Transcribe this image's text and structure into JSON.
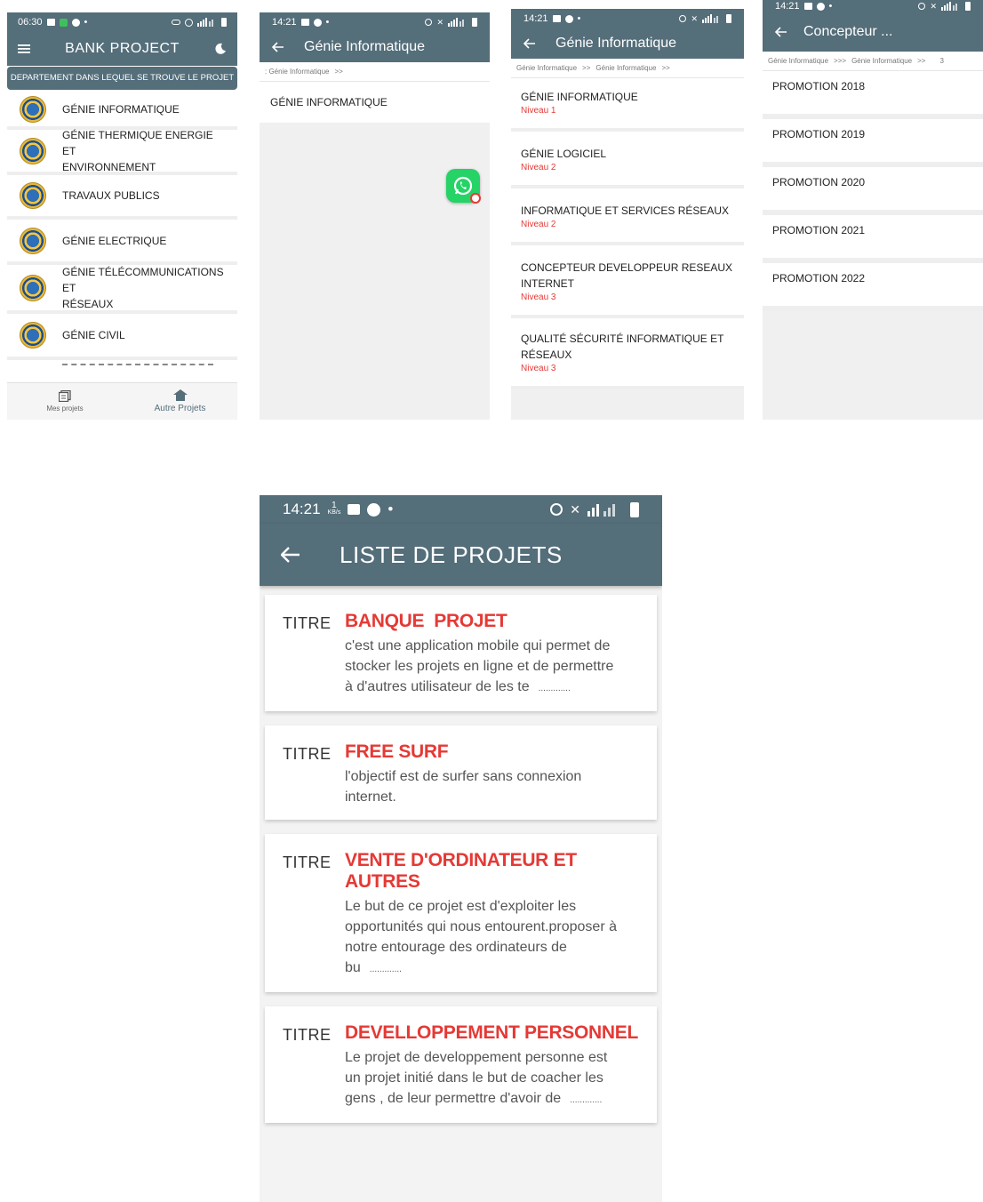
{
  "screen1": {
    "status_time": "06:30",
    "app_title": "BANK PROJECT",
    "section_header": "DEPARTEMENT DANS LEQUEL SE TROUVE LE PROJET",
    "departments": [
      {
        "line1": "GÉNIE INFORMATIQUE",
        "line2": ""
      },
      {
        "line1": "GÉNIE THERMIQUE ENERGIE ET",
        "line2": "ENVIRONNEMENT"
      },
      {
        "line1": "TRAVAUX PUBLICS",
        "line2": ""
      },
      {
        "line1": "GÉNIE ELECTRIQUE",
        "line2": ""
      },
      {
        "line1": "GÉNIE TÉLÉCOMMUNICATIONS ET",
        "line2": "RÉSEAUX"
      },
      {
        "line1": "GÉNIE CIVIL",
        "line2": ""
      }
    ],
    "nav": {
      "left_label": "Mes projets",
      "right_label": "Autre Projets"
    }
  },
  "screen2": {
    "status_time": "14:21",
    "title": "Génie Informatique",
    "crumbs": [
      ": Génie Informatique",
      ">>"
    ],
    "items": [
      "GÉNIE INFORMATIQUE"
    ]
  },
  "screen3": {
    "status_time": "14:21",
    "title": "Génie Informatique",
    "crumbs": [
      "Génie Informatique",
      ">>",
      "Génie Informatique",
      ">>"
    ],
    "items": [
      {
        "line1": "GÉNIE INFORMATIQUE",
        "line2": "",
        "niveau": "Niveau 1"
      },
      {
        "line1": "GÉNIE LOGICIEL",
        "line2": "",
        "niveau": "Niveau 2"
      },
      {
        "line1": "INFORMATIQUE ET SERVICES RÉSEAUX",
        "line2": "",
        "niveau": "Niveau 2"
      },
      {
        "line1": "CONCEPTEUR DEVELOPPEUR RESEAUX",
        "line2": "INTERNET",
        "niveau": "Niveau 3"
      },
      {
        "line1": "QUALITÉ SÉCURITÉ INFORMATIQUE ET",
        "line2": "RÉSEAUX",
        "niveau": "Niveau 3"
      }
    ]
  },
  "screen4": {
    "status_time": "14:21",
    "title": "Concepteur ...",
    "crumbs": [
      "Génie Informatique",
      ">>>",
      "Génie Informatique",
      ">>",
      "3"
    ],
    "items": [
      "PROMOTION 2018",
      "PROMOTION 2019",
      "PROMOTION 2020",
      "PROMOTION 2021",
      "PROMOTION 2022"
    ]
  },
  "screen5": {
    "status_time": "14:21",
    "status_speed_top": "1",
    "status_speed_unit": "KB/s",
    "title": "LISTE DE PROJETS",
    "projects": [
      {
        "label": "TITRE",
        "title": "BANQUE  PROJET",
        "lines": [
          "c'est une application mobile qui permet de",
          "stocker les projets en ligne et de permettre",
          "à d'autres utilisateur de les te"
        ],
        "dots": "............."
      },
      {
        "label": "TITRE",
        "title": "FREE SURF",
        "lines": [
          "l'objectif est de surfer sans connexion",
          "internet."
        ],
        "dots": ""
      },
      {
        "label": "TITRE",
        "title": "VENTE D'ORDINATEUR ET AUTRES",
        "lines": [
          "Le but de ce projet est d'exploiter les",
          "opportunités qui nous entourent.proposer à",
          "notre entourage des ordinateurs de",
          "bu"
        ],
        "dots": "............."
      },
      {
        "label": "TITRE",
        "title": "DEVELLOPPEMENT PERSONNEL",
        "lines": [
          "Le projet de developpement personne est",
          "un projet initié dans le but de coacher les",
          "gens , de leur permettre d'avoir de"
        ],
        "dots": "............."
      }
    ]
  },
  "colors": {
    "appbar": "#546e7a",
    "accent_red": "#e53935",
    "whatsapp": "#25d366"
  },
  "icons": [
    "menu-icon",
    "moon-icon",
    "back-arrow-icon",
    "book-icon",
    "home-icon",
    "whatsapp-icon",
    "alarm-icon",
    "mute-icon",
    "signal-icon",
    "battery-icon",
    "gallery-icon"
  ]
}
